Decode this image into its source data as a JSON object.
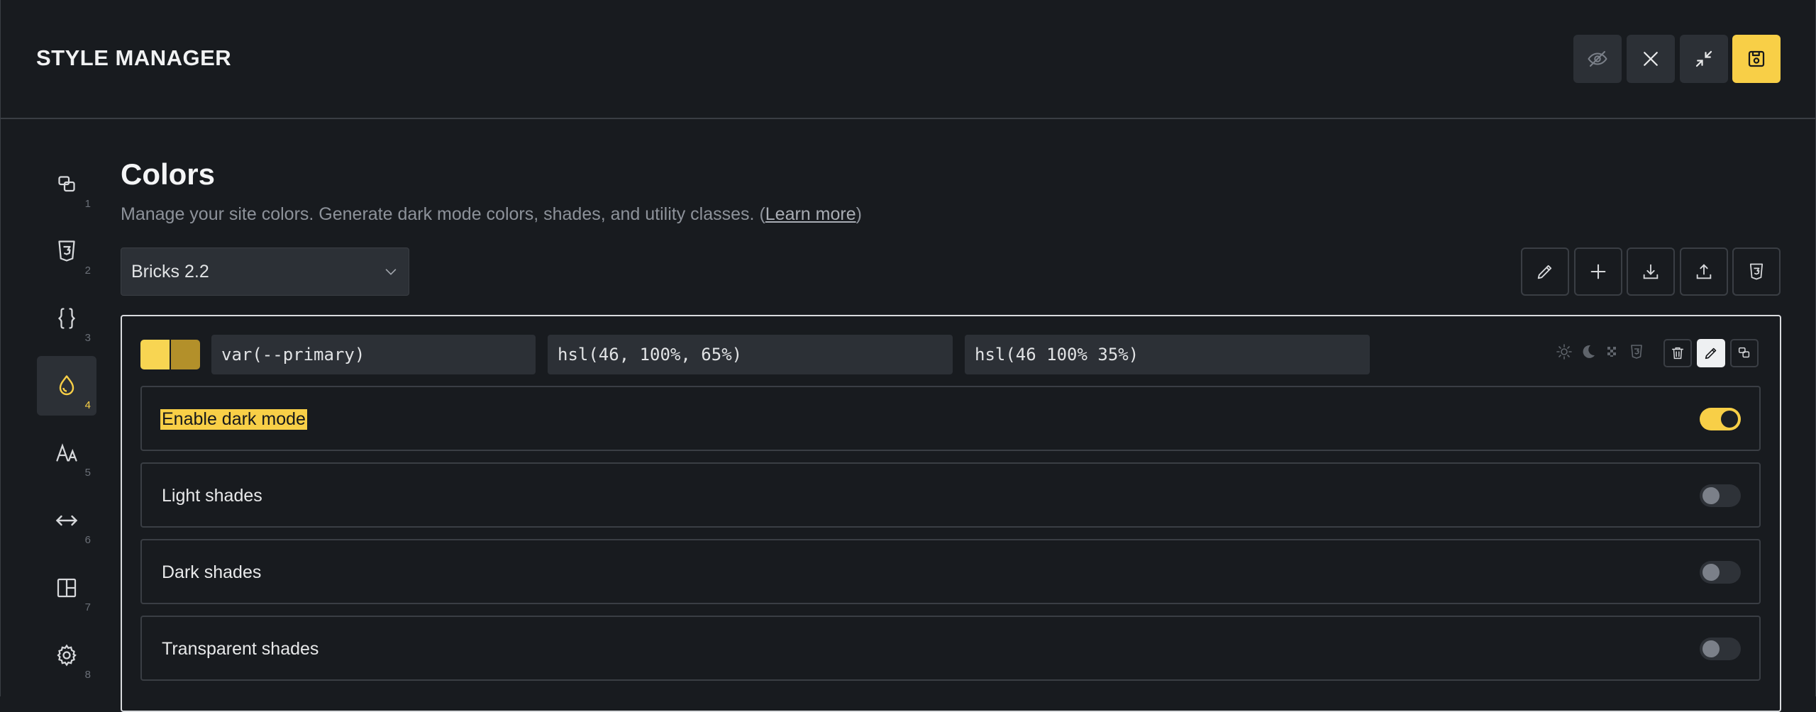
{
  "header": {
    "title": "STYLE MANAGER",
    "buttons": [
      {
        "icon": "eye-off-icon"
      },
      {
        "icon": "close-icon"
      },
      {
        "icon": "minimize-icon"
      },
      {
        "icon": "save-icon"
      }
    ]
  },
  "sidebar": {
    "items": [
      {
        "icon": "paint-icon",
        "num": "1"
      },
      {
        "icon": "css3-icon",
        "num": "2"
      },
      {
        "icon": "braces-icon",
        "num": "3"
      },
      {
        "icon": "drop-icon",
        "num": "4",
        "active": true
      },
      {
        "icon": "typography-icon",
        "num": "5"
      },
      {
        "icon": "spacing-icon",
        "num": "6"
      },
      {
        "icon": "layout-icon",
        "num": "7"
      },
      {
        "icon": "gear-icon",
        "num": "8"
      }
    ]
  },
  "main": {
    "title": "Colors",
    "description": "Manage your site colors. Generate dark mode colors, shades, and utility classes. (",
    "learn_more": "Learn more",
    "description_end": ")",
    "palette_select": "Bricks 2.2",
    "toolbar": [
      "edit-icon",
      "plus-icon",
      "download-icon",
      "upload-icon",
      "css3-icon"
    ]
  },
  "color": {
    "variable": "var(--primary)",
    "light_value": "hsl(46, 100%, 65%)",
    "dark_value": "hsl(46 100% 35%)",
    "swatch_light": "#f8d552",
    "swatch_dark": "#b3902a"
  },
  "options": [
    {
      "label": "Enable dark mode",
      "enabled": true
    },
    {
      "label": "Light shades",
      "enabled": false
    },
    {
      "label": "Dark shades",
      "enabled": false
    },
    {
      "label": "Transparent shades",
      "enabled": false
    }
  ],
  "theme": {
    "accent": "#f8cf47",
    "background": "#181b1f",
    "surface": "#2c3036"
  }
}
